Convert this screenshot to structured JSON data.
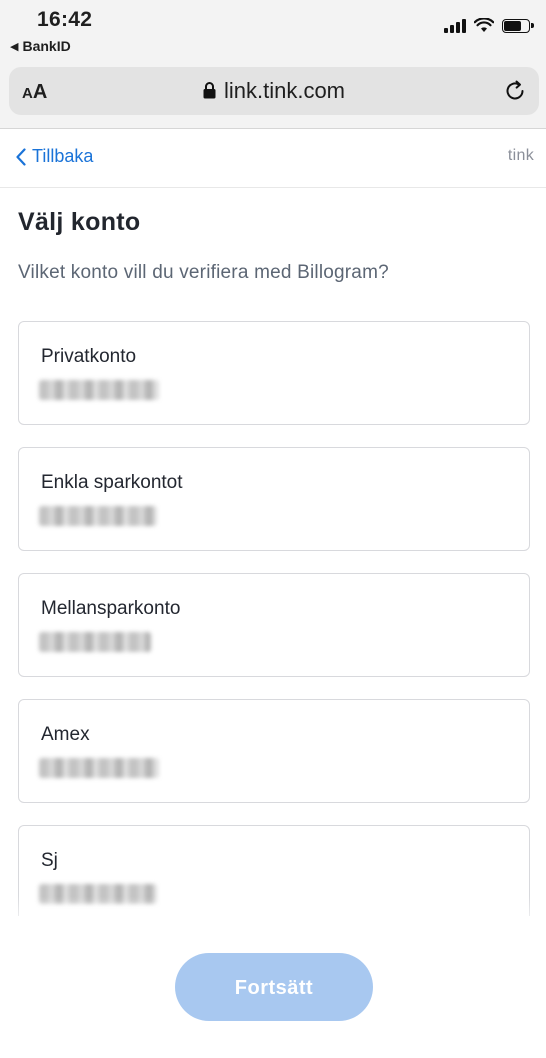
{
  "status_bar": {
    "time": "16:42",
    "back_app": "BankID"
  },
  "browser": {
    "text_size_small": "A",
    "text_size_large": "A",
    "url": "link.tink.com"
  },
  "header": {
    "back_label": "Tillbaka",
    "brand": "tink"
  },
  "page": {
    "title": "Välj konto",
    "subtitle": "Vilket konto vill du verifiera med Billogram?"
  },
  "accounts": [
    {
      "name": "Privatkonto"
    },
    {
      "name": "Enkla sparkontot"
    },
    {
      "name": "Mellansparkonto"
    },
    {
      "name": "Amex"
    },
    {
      "name": "Sj"
    }
  ],
  "footer": {
    "continue_label": "Fortsätt"
  },
  "colors": {
    "link": "#1a73d8",
    "button_disabled": "#a8c8f0"
  }
}
